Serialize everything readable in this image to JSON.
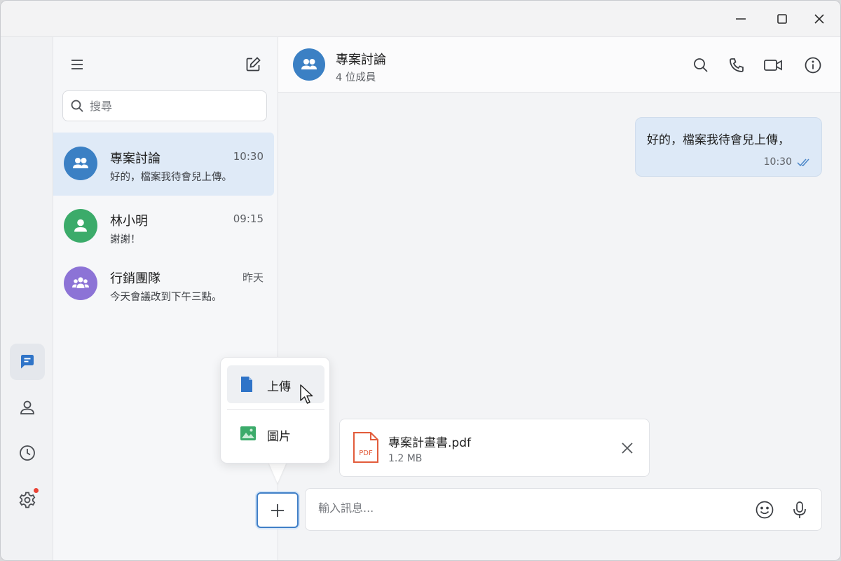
{
  "sidebar": {
    "search_placeholder": "搜尋",
    "conversations": [
      {
        "name": "專案討論",
        "time": "10:30",
        "preview": "好的，檔案我待會兒上傳。",
        "avatar_icon": "group-icon",
        "avatar_color": "#3b80c4",
        "active": true
      },
      {
        "name": "林小明",
        "time": "09:15",
        "preview": "謝謝！",
        "avatar_icon": "person-icon",
        "avatar_color": "#3bab6a",
        "active": false
      },
      {
        "name": "行銷團隊",
        "time": "昨天",
        "preview": "今天會議改到下午三點。",
        "avatar_icon": "team-icon",
        "avatar_color": "#8c73d6",
        "active": false
      }
    ]
  },
  "rail": {
    "items": [
      "chat-icon",
      "contacts-icon",
      "history-icon",
      "settings-icon"
    ],
    "active_color": "#2f74c8",
    "notification_color": "#ea4335"
  },
  "chat": {
    "title": "專案討論",
    "subtitle": "4 位成員",
    "messages": [
      {
        "text": "好的，檔案我待會兒上傳，",
        "time": "10:30",
        "status": "read"
      }
    ],
    "attachment": {
      "name": "專案計畫書.pdf",
      "size": "1.2 MB",
      "icon_label": "PDF"
    },
    "input_placeholder": "輸入訊息..."
  },
  "popup_menu": {
    "items": [
      {
        "label": "上傳",
        "icon": "file-icon",
        "color": "#2f74c8"
      },
      {
        "label": "圖片",
        "icon": "image-icon",
        "color": "#3bab6a"
      }
    ]
  }
}
